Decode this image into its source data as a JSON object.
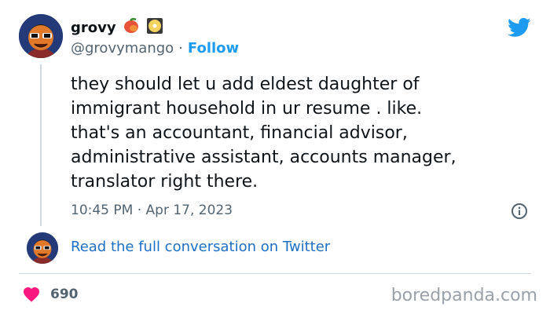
{
  "tweet": {
    "display_name": "grovy",
    "handle": "@grovymango",
    "separator": "·",
    "follow_label": "Follow",
    "text": "they should let u add eldest daughter of\nimmigrant household in ur resume . like.\nthat's an accountant, financial advisor,\nadministrative assistant, accounts manager,\ntranslator right there.",
    "timestamp": "10:45 PM · Apr 17, 2023",
    "read_full_label": "Read the full conversation on Twitter",
    "like_count": "690"
  },
  "watermark": "boredpanda.com",
  "icons": {
    "name_emojis": [
      "mango-emoji-icon",
      "disc-emoji-icon"
    ],
    "brand": "twitter-bird-icon",
    "info": "info-icon",
    "like": "heart-icon"
  },
  "colors": {
    "follow": "#1d9bf0",
    "link": "#1d6fc4",
    "heart": "#f91880",
    "muted": "#536471",
    "brand": "#1d9bf0"
  }
}
